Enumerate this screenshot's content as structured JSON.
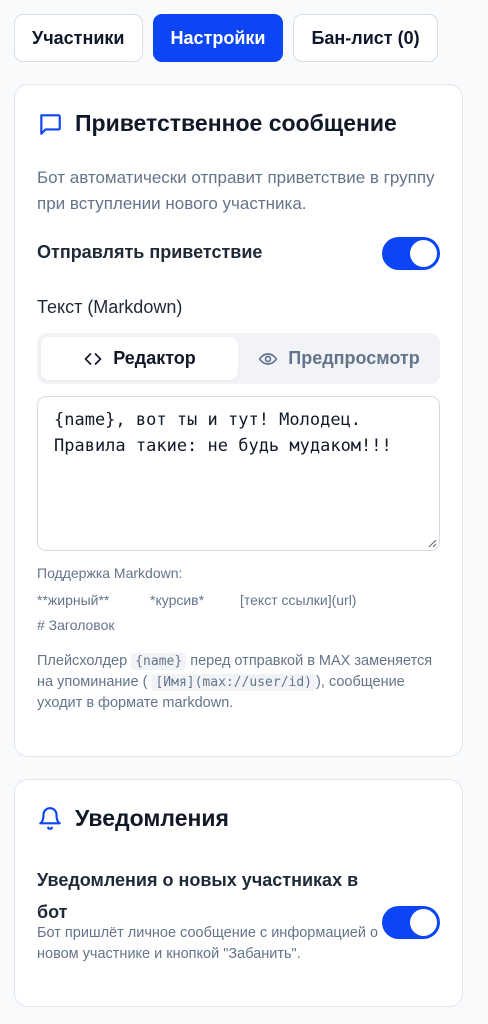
{
  "tabs": {
    "members": "Участники",
    "settings": "Настройки",
    "banlist": "Бан-лист (0)"
  },
  "welcome": {
    "title": "Приветственное сообщение",
    "description": "Бот автоматически отправит приветствие в группу при вступлении нового участника.",
    "send_label": "Отправлять приветствие",
    "send_enabled": true,
    "text_label": "Текст (Markdown)",
    "mode_editor": "Редактор",
    "mode_preview": "Предпросмотр",
    "text_value": "{name}, вот ты и тут! Молодец. Правила такие: не будь мудаком!!!",
    "markdown_support": "Поддержка Markdown:",
    "md_bold": "**жирный**",
    "md_italic": "*курсив*",
    "md_link": "[текст ссылки](url)",
    "md_heading": "# Заголовок",
    "note_part1": "Плейсхолдер",
    "note_code1": "{name}",
    "note_part2": "перед отправкой в MAX заменяется на упоминание (",
    "note_code2": "[Имя](max://user/id)",
    "note_part3": "), сообщение уходит в формате markdown."
  },
  "notifications": {
    "title": "Уведомления",
    "new_members_label": "Уведомления о новых участниках в бот",
    "new_members_enabled": true,
    "new_members_desc": "Бот пришлёт личное сообщение с информацией о новом участнике и кнопкой \"Забанить\"."
  },
  "colors": {
    "accent": "#0b45f5",
    "muted_text": "#64748b"
  },
  "icons": {
    "welcome": "message-square-icon",
    "editor": "code-icon",
    "preview": "eye-icon",
    "notifications": "bell-icon"
  }
}
